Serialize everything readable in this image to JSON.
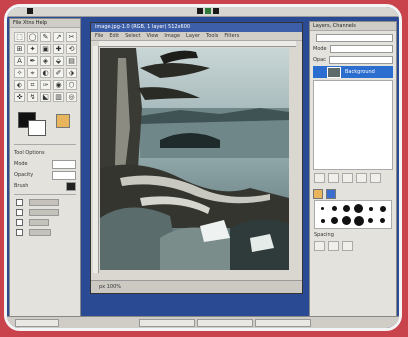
{
  "toolbox": {
    "title": "File  Xtns  Help",
    "tools": [
      "⬚",
      "◯",
      "✎",
      "↗",
      "✂",
      "⊞",
      "✦",
      "▣",
      "✚",
      "⟲",
      "A",
      "✒",
      "◈",
      "⬙",
      "▤",
      "✧",
      "⌖",
      "◐",
      "✐",
      "⬗",
      "⬖",
      "⌗",
      "✑",
      "◉",
      "⬡",
      "✜",
      "↯",
      "⬕",
      "▥",
      "◎"
    ],
    "options_title": "Tool Options",
    "opt1": "Mode",
    "opt2": "Opacity",
    "opt3": "Brush"
  },
  "image_window": {
    "title": "image.jpg-1.0 (RGB, 1 layer) 512x600",
    "menu": [
      "File",
      "Edit",
      "Select",
      "View",
      "Image",
      "Layer",
      "Tools",
      "Filters"
    ],
    "status": "px  100%"
  },
  "dock": {
    "title": "Layers, Channels",
    "mode_label": "Mode",
    "opacity_label": "Opac",
    "layer_name": "Background",
    "spacing": "Spacing"
  },
  "brushes": [
    3,
    5,
    7,
    9,
    4,
    6,
    4,
    7,
    9,
    10,
    5,
    5
  ],
  "taskbar": [
    "",
    "",
    "",
    ""
  ]
}
